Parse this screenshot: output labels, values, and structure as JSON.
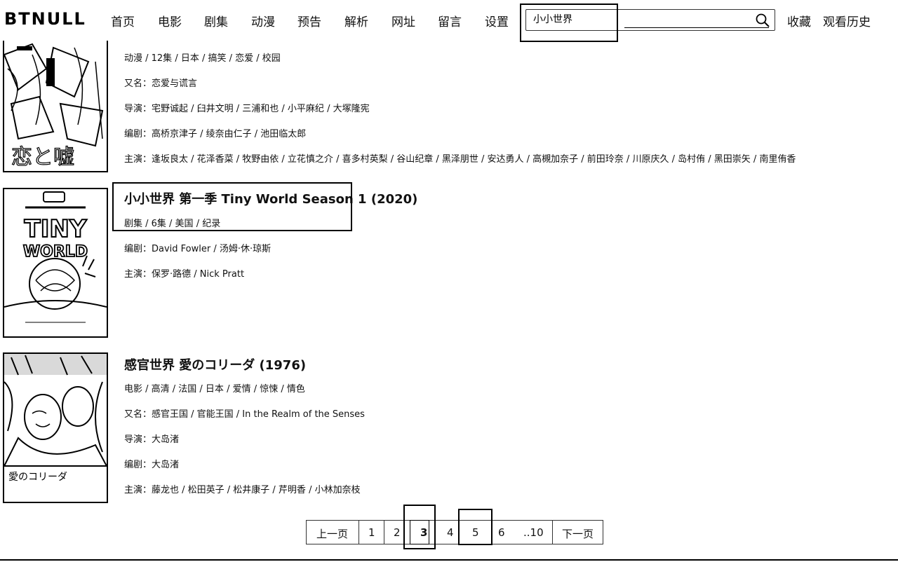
{
  "brand": "BTNULL",
  "nav": [
    "首页",
    "电影",
    "剧集",
    "动漫",
    "预告",
    "解析",
    "网址",
    "留言",
    "设置"
  ],
  "search": {
    "value": "小小世界"
  },
  "right_links": {
    "favorites": "收藏",
    "history": "观看历史"
  },
  "items": [
    {
      "rows": [
        "动漫 / 12集 / 日本 / 搞笑 / 恋爱 / 校园",
        "又名：恋爱与谎言",
        "导演：宅野诚起 / 臼井文明 / 三浦和也 / 小平麻纪 / 大塚隆宪",
        "编剧：高桥京津子 / 绫奈由仁子 / 池田临太郎",
        "主演：逢坂良太 / 花泽香菜 / 牧野由依 / 立花慎之介 / 喜多村英梨 / 谷山纪章 / 黑泽朋世 / 安达勇人 / 高槻加奈子 / 前田玲奈 / 川原庆久 / 岛村侑 / 黑田崇矢 / 南里侑香"
      ],
      "poster_caption": "恋と嘘"
    },
    {
      "title": "小小世界 第一季 Tiny World Season 1 (2020)",
      "rows": [
        "剧集 / 6集 / 美国 / 纪录",
        "编剧：David Fowler / 汤姆·休·琼斯",
        "主演：保罗·路德 / Nick Pratt"
      ],
      "poster_text": [
        "TINY",
        "WORLD"
      ]
    },
    {
      "title": "感官世界 愛のコリーダ (1976)",
      "rows": [
        "电影 / 高清 / 法国 / 日本 / 爱情 / 惊悚 / 情色",
        "又名：感官王国 / 官能王国 / In the Realm of the Senses",
        "导演：大岛渚",
        "编剧：大岛渚",
        "主演：藤龙也 / 松田英子 / 松井康子 / 芹明香 / 小林加奈枝"
      ],
      "poster_caption": "愛のコリーダ"
    }
  ],
  "pager": {
    "prev": "上一页",
    "pages": [
      "1",
      "2",
      "3",
      "4",
      "5",
      "6",
      "..10"
    ],
    "next": "下一页",
    "current": "3"
  }
}
